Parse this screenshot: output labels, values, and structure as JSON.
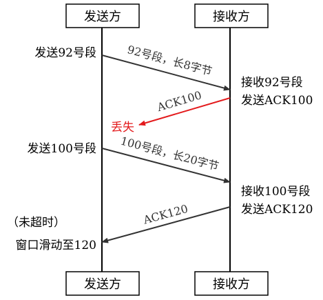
{
  "sender": {
    "top_label": "发送方",
    "bottom_label": "发送方"
  },
  "receiver": {
    "top_label": "接收方",
    "bottom_label": "接收方"
  },
  "sender_notes": {
    "send92": "发送92号段",
    "send100": "发送100号段",
    "not_timeout": "（未超时）",
    "window_slide": "窗口滑动至120"
  },
  "receiver_notes": {
    "recv92_line1": "接收92号段",
    "recv92_line2": "发送ACK100",
    "recv100_line1": "接收100号段",
    "recv100_line2": "发送ACK120"
  },
  "messages": {
    "seg92": "92号段，长8字节",
    "ack100": "ACK100",
    "lost": "丢失",
    "seg100": "100号段，长20字节",
    "ack120": "ACK120"
  },
  "colors": {
    "line": "#000000",
    "arrow": "#333333",
    "lost": "#e31a1c",
    "text": "#000000"
  }
}
